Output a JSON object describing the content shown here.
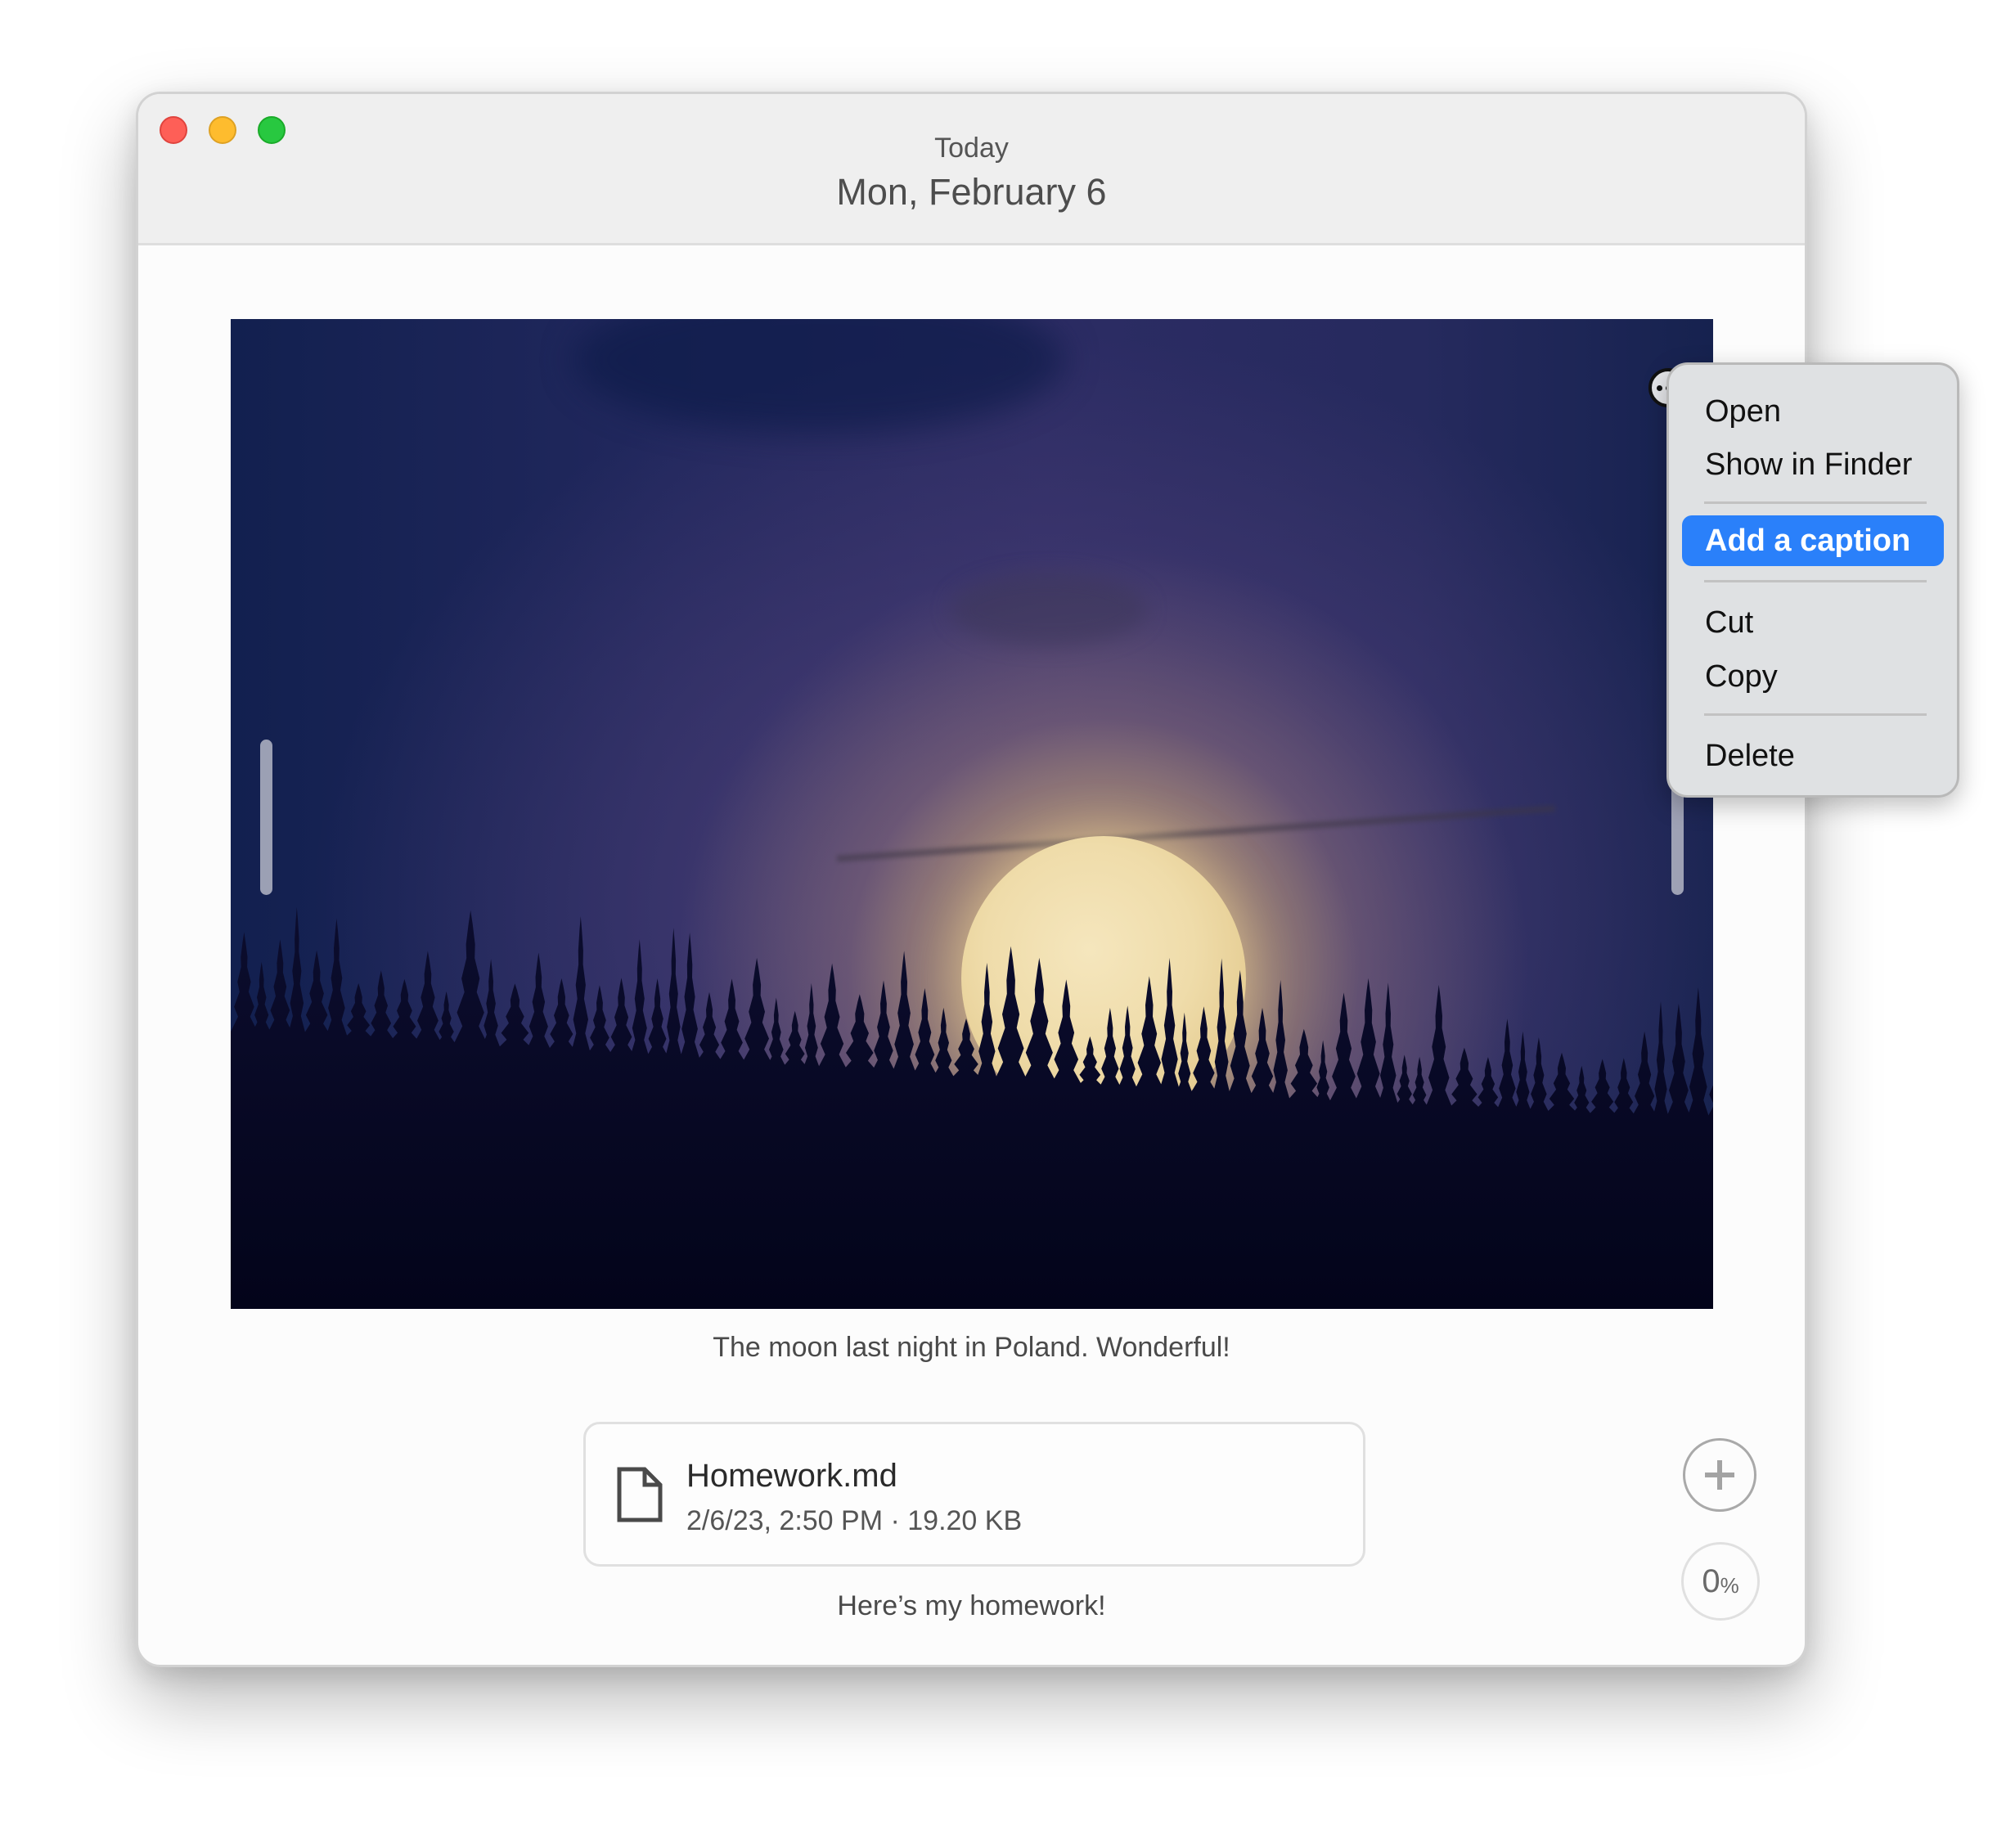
{
  "window": {
    "traffic_lights": {
      "close": "close",
      "minimize": "minimize",
      "zoom": "zoom"
    },
    "title_sub": "Today",
    "title_main": "Mon, February 6"
  },
  "entries": [
    {
      "type": "photo",
      "description": "Full moon rising behind a forest of pine trees at night",
      "caption": "The moon last night in Poland. Wonderful!"
    },
    {
      "type": "file",
      "file_name": "Homework.md",
      "file_meta": "2/6/23, 2:50 PM · 19.20 KB",
      "caption": "Here’s my homework!"
    }
  ],
  "controls": {
    "add_icon": "plus-icon",
    "progress_value": "0",
    "progress_unit": "%"
  },
  "context_menu": {
    "items": [
      {
        "label": "Open"
      },
      {
        "label": "Show in Finder"
      },
      {
        "label": "Add a caption",
        "highlighted": true
      },
      {
        "label": "Cut"
      },
      {
        "label": "Copy"
      },
      {
        "label": "Delete"
      }
    ]
  },
  "colors": {
    "menu_highlight": "#2a80fa",
    "close": "#fe5f57",
    "minimize": "#febc2e",
    "zoom": "#28c840"
  }
}
